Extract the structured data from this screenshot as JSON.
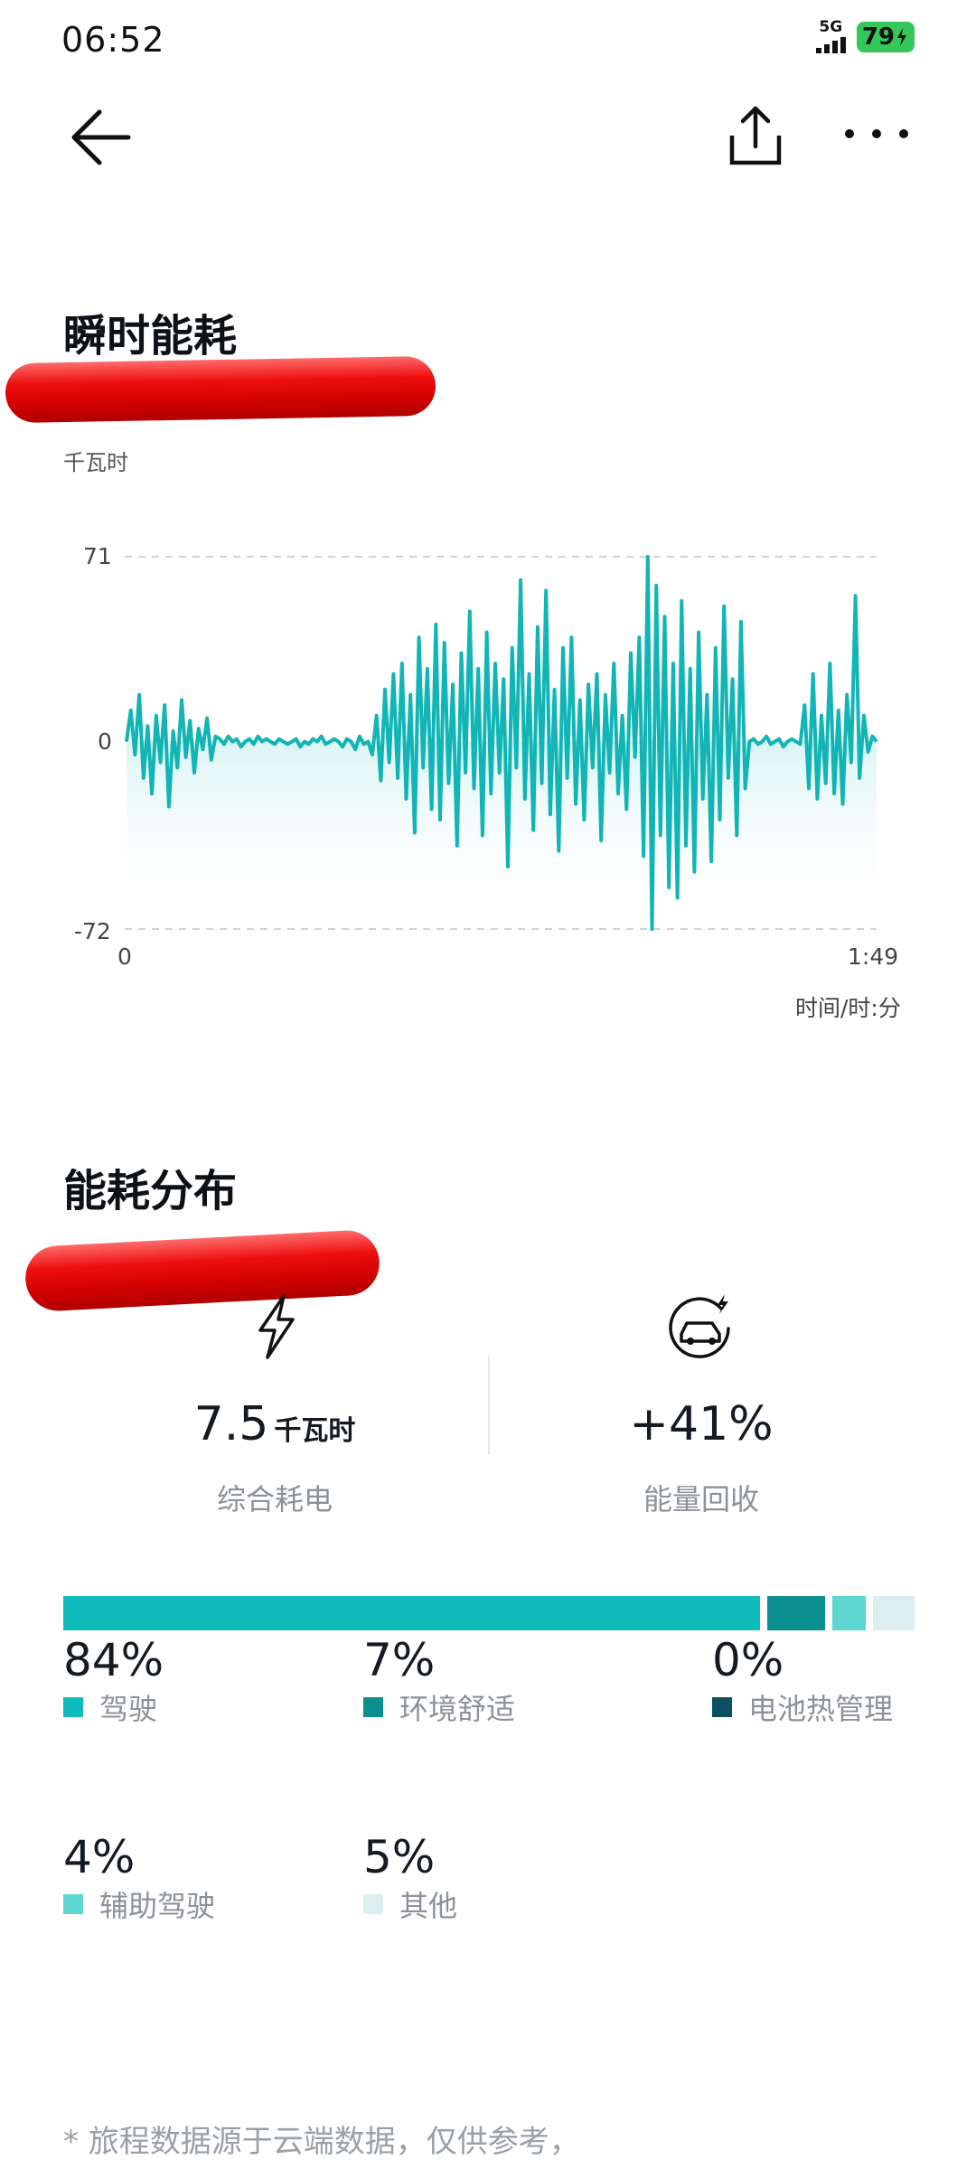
{
  "status_bar": {
    "time": "06:52",
    "network": "5G",
    "battery": "79"
  },
  "instant": {
    "title": "瞬时能耗",
    "unit": "千瓦时",
    "chart": {
      "y_top": "71",
      "y_mid": "0",
      "y_bottom": "-72",
      "x_start": "0",
      "x_end": "1:49",
      "x_label": "时间/时:分"
    }
  },
  "chart_data": {
    "type": "line",
    "xlabel": "时间/时:分",
    "ylabel": "千瓦时",
    "ylim": [
      -72,
      71
    ],
    "x_range": [
      "0",
      "1:49"
    ],
    "grid": true,
    "series": [
      {
        "color": "#12b5b5",
        "values": [
          0,
          12,
          -5,
          18,
          -14,
          6,
          -20,
          10,
          -8,
          14,
          -25,
          4,
          -10,
          16,
          -6,
          8,
          -12,
          5,
          -3,
          9,
          -7,
          2,
          1,
          -1,
          2,
          0,
          1,
          -2,
          0,
          1,
          -1,
          2,
          0,
          1,
          0,
          -1,
          1,
          0,
          -1,
          0,
          1,
          -2,
          0,
          -1,
          1,
          0,
          2,
          -1,
          0,
          1,
          0,
          -2,
          1,
          0,
          -3,
          2,
          -1,
          0,
          -5,
          10,
          -15,
          20,
          -8,
          26,
          -14,
          30,
          -22,
          18,
          -35,
          40,
          -10,
          28,
          -26,
          45,
          -30,
          38,
          -16,
          22,
          -40,
          34,
          -12,
          50,
          -18,
          28,
          -36,
          42,
          -20,
          30,
          -12,
          24,
          -48,
          36,
          -10,
          62,
          -22,
          26,
          -34,
          44,
          -16,
          58,
          -28,
          20,
          -42,
          36,
          -14,
          40,
          -24,
          16,
          -30,
          22,
          -10,
          26,
          -38,
          18,
          -12,
          30,
          -20,
          10,
          -26,
          34,
          -6,
          40,
          -44,
          71,
          -72,
          60,
          -36,
          48,
          -56,
          30,
          -60,
          54,
          -40,
          28,
          -50,
          42,
          -22,
          18,
          -46,
          36,
          -30,
          52,
          -14,
          24,
          -36,
          46,
          -18,
          0,
          1,
          -1,
          0,
          2,
          -1,
          0,
          1,
          -2,
          0,
          1,
          0,
          -1,
          14,
          -18,
          26,
          -22,
          10,
          -16,
          30,
          -20,
          12,
          -24,
          18,
          -8,
          56,
          -14,
          10,
          -4,
          2,
          0
        ]
      }
    ]
  },
  "distribution": {
    "title": "能耗分布",
    "energy_value": "7.5",
    "energy_unit": "千瓦时",
    "energy_caption": "综合耗电",
    "recovery_value": "+41%",
    "recovery_caption": "能量回收",
    "segments": [
      {
        "label": "驾驶",
        "pct": "84%",
        "share": 84,
        "color": "#0fbbbb"
      },
      {
        "label": "环境舒适",
        "pct": "7%",
        "share": 7,
        "color": "#0c8f8f"
      },
      {
        "label": "电池热管理",
        "pct": "0%",
        "share": 0,
        "color": "#0b4f61"
      },
      {
        "label": "辅助驾驶",
        "pct": "4%",
        "share": 4,
        "color": "#5cd6cf"
      },
      {
        "label": "其他",
        "pct": "5%",
        "share": 5,
        "color": "#dbeff1"
      }
    ],
    "footnote": "* 旅程数据源于云端数据，仅供参考，"
  }
}
